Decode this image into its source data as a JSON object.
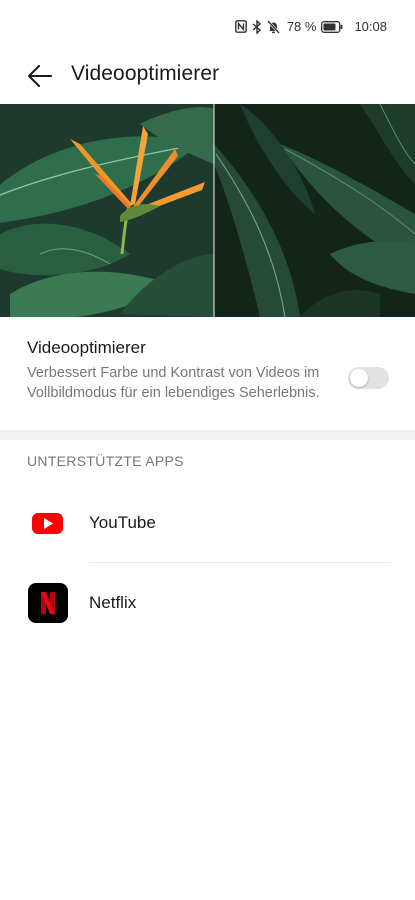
{
  "status_bar": {
    "battery_percent": "78 %",
    "time": "10:08",
    "icons": [
      "nfc-icon",
      "bluetooth-icon",
      "mute-icon",
      "battery-icon"
    ]
  },
  "header": {
    "title": "Videooptimierer",
    "back_icon": "arrow-left-icon"
  },
  "setting": {
    "title": "Videooptimierer",
    "description": "Verbessert Farbe und Kontrast von Videos im Vollbildmodus für ein lebendiges Seherlebnis.",
    "toggle_on": false
  },
  "supported_apps": {
    "header": "UNTERSTÜTZTE APPS",
    "items": [
      {
        "label": "YouTube",
        "icon": "youtube-icon"
      },
      {
        "label": "Netflix",
        "icon": "netflix-icon"
      }
    ]
  },
  "colors": {
    "toggle_off": "#e2e2e2",
    "youtube_red": "#ff0000",
    "netflix_red": "#e50914",
    "netflix_bg": "#000000"
  }
}
